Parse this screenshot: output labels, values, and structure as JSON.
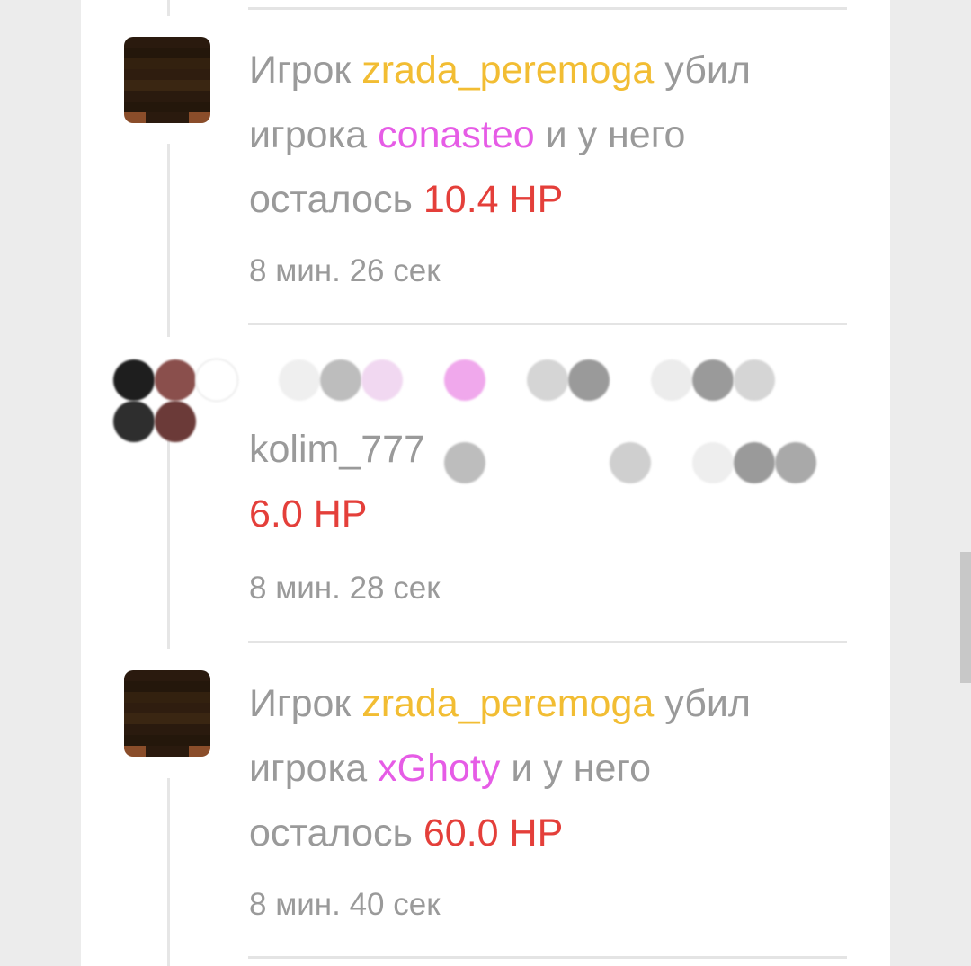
{
  "entries": [
    {
      "prefix": "Игрок ",
      "killer": "zrada_peremoga",
      "mid": " убил игрока ",
      "victim": "conasteo",
      "tail": " и у него осталось ",
      "hp": "10.4 HP",
      "time": "8 мин. 26 сек"
    },
    {
      "visible_start": "kolim_777",
      "hp": "6.0 HP",
      "time": "8 мин. 28 сек"
    },
    {
      "prefix": "Игрок ",
      "killer": "zrada_peremoga",
      "mid": " убил игрока ",
      "victim": "xGhoty",
      "tail": " и у него осталось ",
      "hp": "60.0 HP",
      "time": "8 мин. 40 сек"
    }
  ],
  "colors": {
    "killer": "#f2bd33",
    "victim": "#e65ce6",
    "hp": "#e43f3a",
    "text": "#9a9a9a"
  },
  "icons": {
    "avatar": "player-skin-avatar"
  }
}
